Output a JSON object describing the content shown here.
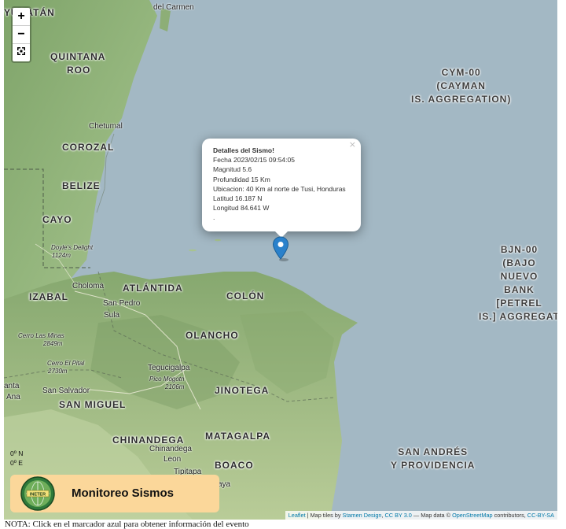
{
  "zoom_controls": {
    "zoom_in": "+",
    "zoom_out": "−",
    "fullscreen": "⛶"
  },
  "regions": {
    "yucatan": "YUCATÁN",
    "quintana_roo_1": "QUINTANA",
    "quintana_roo_2": "ROO",
    "corozal": "COROZAL",
    "belize": "BELIZE",
    "cayo": "CAYO",
    "izabal": "IZABAL",
    "atlantida": "ATLÁNTIDA",
    "colon": "COLÓN",
    "olancho": "OLANCHO",
    "san_miguel": "SAN MIGUEL",
    "jinotega": "JINOTEGA",
    "chinandega": "CHINANDEGA",
    "matagalpa": "MATAGALPA",
    "boaco": "BOACO",
    "santa_ana_1": "anta",
    "santa_ana_2": "Ana"
  },
  "sea_labels": {
    "cayman": "CYM-00 (CAYMAN IS. AGGREGATION)",
    "cayman_lines": [
      "CYM-00",
      "(CAYMAN",
      "IS. AGGREGATION)"
    ],
    "bajo_nuevo_lines": [
      "BJN-00",
      "(BAJO",
      "NUEVO",
      "BANK",
      "[PETREL",
      "IS.] AGGREGAT"
    ],
    "san_andres_lines": [
      "SAN ANDRÉS",
      "Y PROVIDENCIA"
    ]
  },
  "cities": {
    "del_carmen": "del Carmen",
    "chetumal": "Chetumal",
    "choloma": "Choloma",
    "san_pedro_1": "San Pedro",
    "san_pedro_2": "Sula",
    "tegucigalpa": "Tegucigalpa",
    "san_salvador": "San Salvador",
    "chinandega": "Chinandega",
    "leon": "Leon",
    "tipitapa": "Tipitapa",
    "aya": "aya"
  },
  "peaks": {
    "doyles_1": "Doyle's Delight",
    "doyles_2": "1124m",
    "cerro_minas_1": "Cerro Las Minas",
    "cerro_minas_2": "2849m",
    "cerro_pital_1": "Cerro El Pital",
    "cerro_pital_2": "2730m",
    "pico_mogotn_1": "Pico Mogotn",
    "pico_mogotn_2": "2106m"
  },
  "popup": {
    "title": "Detalles del Sismo!",
    "lines": [
      "Fecha 2023/02/15 09:54:05",
      "Magnitud 5.6",
      "Profundidad 15 Km",
      "Ubicacion: 40 Km al norte de Tusi, Honduras",
      "Latitud 16.187 N",
      "Longitud 84.641 W",
      "."
    ],
    "close": "×"
  },
  "coords": {
    "lat": "0º N",
    "lon": "0º E"
  },
  "logo": {
    "title": "Monitoreo Sismos",
    "badge": "INETER"
  },
  "attribution": {
    "leaflet": "Leaflet",
    "sep1": " | Map tiles by ",
    "stamen": "Stamen Design",
    "sep2": ", ",
    "ccby": "CC BY 3.0",
    "sep3": " — Map data © ",
    "osm": "OpenStreetMap",
    "sep4": " contributors, ",
    "ccbysa": "CC-BY-SA"
  },
  "note": "NOTA: Click en el marcador azul para obtener información del evento",
  "colors": {
    "sea": "#a3b8c4",
    "land": "#8fb07a",
    "marker": "#2a81cb",
    "logo_bg": "#fbd79a"
  }
}
